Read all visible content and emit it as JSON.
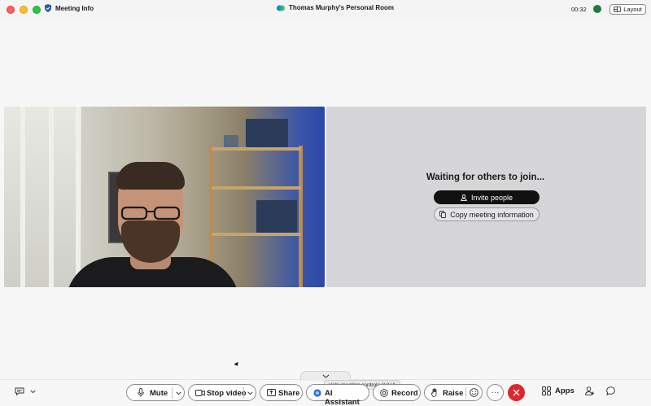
{
  "titlebar": {
    "meeting_info_label": "Meeting Info",
    "room_title": "Thomas Murphy's Personal Room",
    "timer": "00:32",
    "layout_label": "Layout"
  },
  "waiting_panel": {
    "title": "Waiting for others to join...",
    "invite_label": "Invite people",
    "copy_label": "Copy meeting information"
  },
  "controls": {
    "mute_label": "Mute",
    "stop_video_label": "Stop video",
    "share_label": "Share",
    "ai_assistant_label": "AI Assistant",
    "record_label": "Record",
    "raise_label": "Raise",
    "more_label": "···",
    "apps_label": "Apps",
    "tooltip": "Hide meeting controls (^⇧H)"
  },
  "colors": {
    "end_call": "#e0262b",
    "status_green": "#1f7a3a",
    "invite_bg": "#111111"
  },
  "icons": [
    "shield-icon",
    "webex-logo-icon",
    "layout-icon",
    "person-icon",
    "copy-icon",
    "captions-icon",
    "chevron-down-icon",
    "microphone-icon",
    "camera-icon",
    "share-icon",
    "ai-assistant-icon",
    "record-icon",
    "hand-icon",
    "reactions-icon",
    "more-icon",
    "end-call-icon",
    "apps-icon",
    "participants-icon",
    "chat-icon"
  ]
}
